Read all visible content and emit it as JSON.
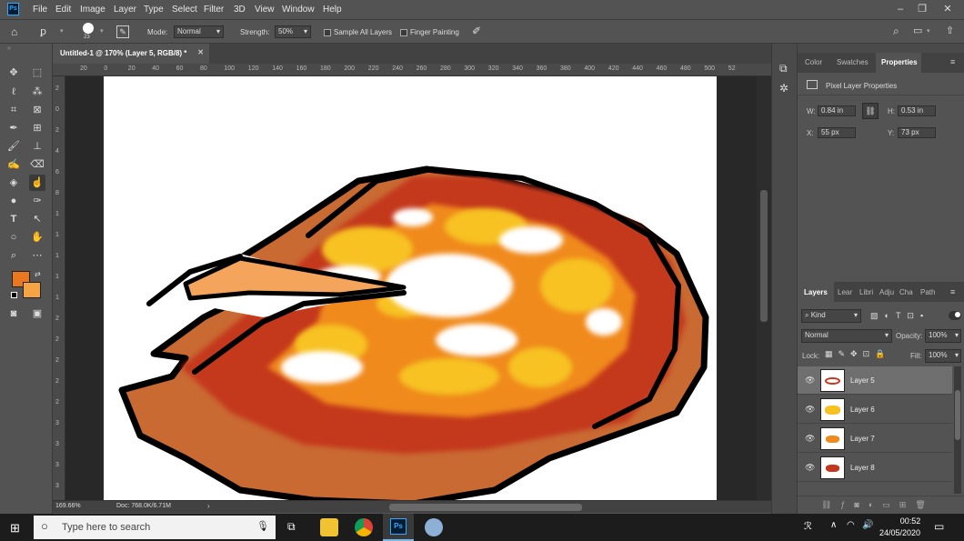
{
  "menubar": {
    "logo": "Ps",
    "items": [
      "File",
      "Edit",
      "Image",
      "Layer",
      "Type",
      "Select",
      "Filter",
      "3D",
      "View",
      "Window",
      "Help"
    ]
  },
  "options": {
    "brush_size": "23",
    "mode_label": "Mode:",
    "mode_value": "Normal",
    "strength_label": "Strength:",
    "strength_value": "50%",
    "sample_all_layers": "Sample All Layers",
    "finger_painting": "Finger Painting"
  },
  "document": {
    "tab_title": "Untitled-1 @ 170% (Layer 5, RGB/8) *",
    "zoom": "169.66%",
    "doc_info": "Doc: 768.0K/6.71M",
    "hruler": [
      "20",
      "0",
      "20",
      "40",
      "60",
      "80",
      "100",
      "120",
      "140",
      "160",
      "180",
      "200",
      "220",
      "240",
      "260",
      "280",
      "300",
      "320",
      "340",
      "360",
      "380",
      "400",
      "420",
      "440",
      "460",
      "480",
      "500",
      "52"
    ],
    "vruler": [
      "2",
      "0",
      "2",
      "4",
      "6",
      "8",
      "1",
      "1",
      "1",
      "1",
      "1",
      "2",
      "2",
      "2",
      "2",
      "2",
      "3",
      "3",
      "3",
      "3"
    ]
  },
  "properties": {
    "tabs": [
      "Color",
      "Swatches",
      "Properties"
    ],
    "title": "Pixel Layer Properties",
    "w_label": "W:",
    "w_value": "0.84 in",
    "h_label": "H:",
    "h_value": "0.53 in",
    "x_label": "X:",
    "x_value": "55 px",
    "y_label": "Y:",
    "y_value": "73 px"
  },
  "layers": {
    "tabs": [
      "Layers",
      "Lear",
      "Libri",
      "Adju",
      "Cha",
      "Path"
    ],
    "filter_kind": "Kind",
    "blend_mode": "Normal",
    "opacity_label": "Opacity:",
    "opacity_value": "100%",
    "lock_label": "Lock:",
    "fill_label": "Fill:",
    "fill_value": "100%",
    "rows": [
      "Layer 5",
      "Layer 6",
      "Layer 7",
      "Layer 8"
    ]
  },
  "taskbar": {
    "search_placeholder": "Type here to search",
    "time": "00:52",
    "date": "24/05/2020"
  },
  "colors": {
    "foreground": "#e8771f",
    "background": "#f5a443"
  }
}
